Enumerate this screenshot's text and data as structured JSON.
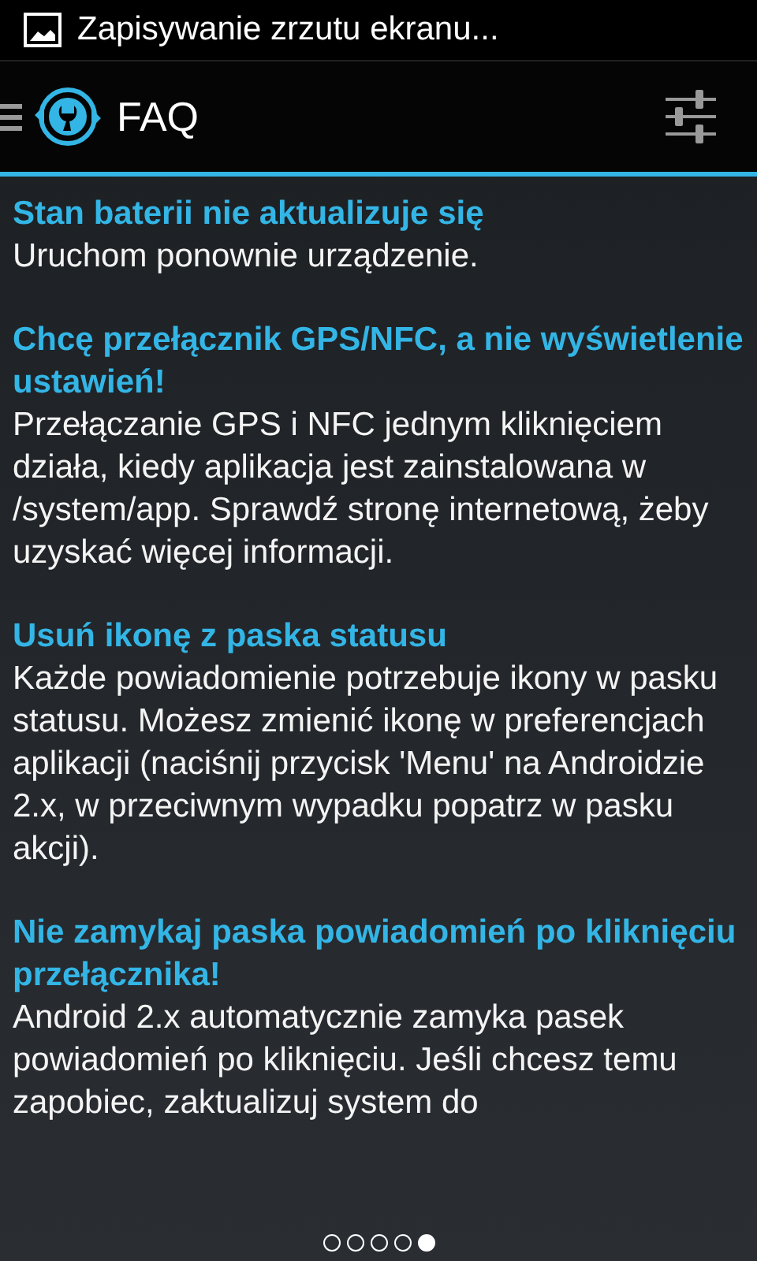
{
  "status_bar": {
    "notification": "Zapisywanie zrzutu ekranu..."
  },
  "action_bar": {
    "title": "FAQ"
  },
  "faq": [
    {
      "question": "Stan baterii nie aktualizuje się",
      "answer": "Uruchom ponownie urządzenie."
    },
    {
      "question": "Chcę przełącznik GPS/NFC, a nie wyświetlenie ustawień!",
      "answer": "Przełączanie GPS i NFC jednym kliknięciem działa, kiedy aplikacja jest zainstalowana w /system/app. Sprawdź stronę internetową, żeby uzyskać więcej informacji."
    },
    {
      "question": "Usuń ikonę z paska statusu",
      "answer": "Każde powiadomienie potrzebuje ikony w pasku statusu. Możesz zmienić ikonę w preferencjach aplikacji (naciśnij przycisk 'Menu' na Androidzie 2.x, w przeciwnym wypadku popatrz w pasku akcji)."
    },
    {
      "question": "Nie zamykaj paska powiadomień po kliknięciu przełącznika!",
      "answer": "Android 2.x automatycznie zamyka pasek powiadomień po kliknięciu. Jeśli chcesz temu zapobiec, zaktualizuj system do"
    }
  ],
  "pages": [
    {
      "selected": false
    },
    {
      "selected": false
    },
    {
      "selected": false
    },
    {
      "selected": false
    },
    {
      "selected": true
    }
  ]
}
